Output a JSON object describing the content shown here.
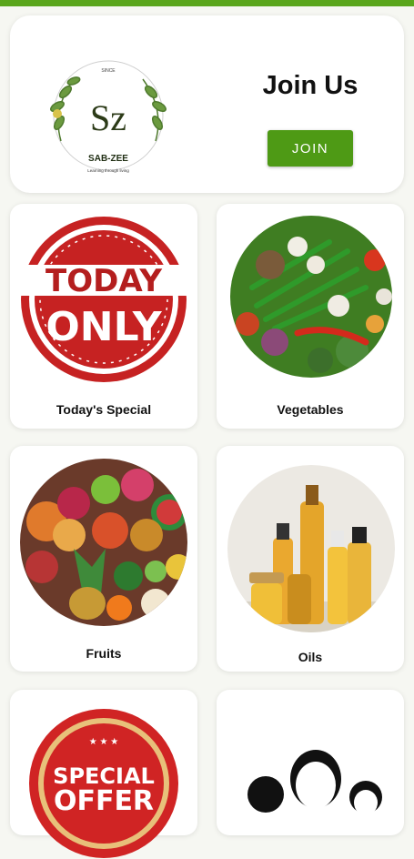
{
  "header": {
    "logo_lines": [
      "SINCE",
      "Sz",
      "SAB-ZEE",
      "Learning through living"
    ],
    "join_title": "Join Us",
    "join_button": "JOIN"
  },
  "tiles": [
    {
      "label": "Today's Special",
      "image_text": [
        "TODAY",
        "ONLY"
      ]
    },
    {
      "label": "Vegetables"
    },
    {
      "label": "Fruits"
    },
    {
      "label": "Oils"
    },
    {
      "label": "",
      "image_text": [
        "SPECIAL",
        "OFFER"
      ]
    },
    {
      "label": ""
    }
  ],
  "colors": {
    "accent": "#5aa61c",
    "button": "#4e9a15",
    "offer_red": "#c62222"
  }
}
